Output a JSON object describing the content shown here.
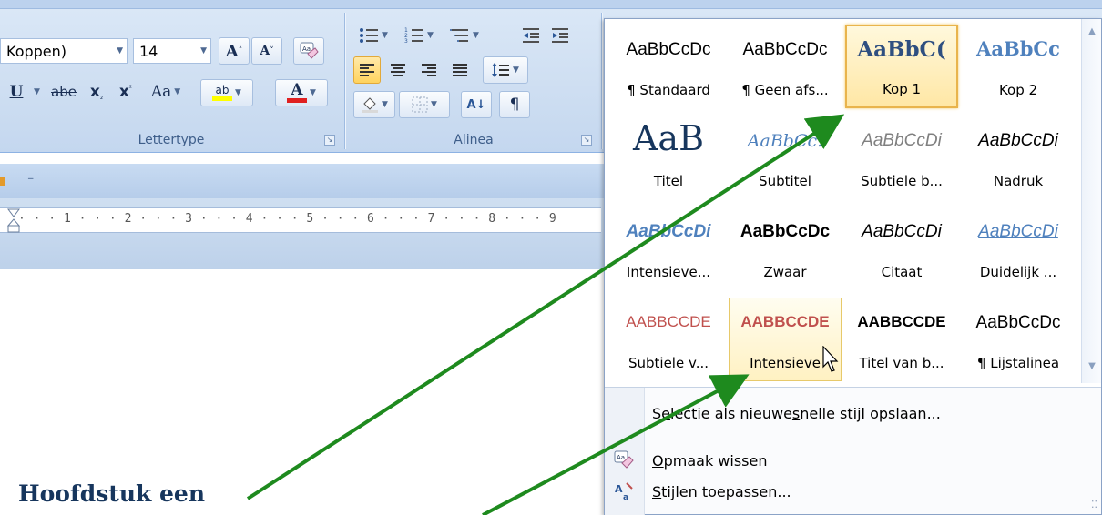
{
  "ribbon": {
    "font": {
      "name_value": "Koppen)",
      "size_value": "14",
      "group_label": "Lettertype",
      "grow_label": "A",
      "shrink_label": "A",
      "underline_label": "U",
      "strike_label": "abe",
      "subscript_label": "x",
      "superscript_label": "x",
      "case_label": "Aa",
      "highlight_label": "ab",
      "color_label": "A",
      "highlight_color": "#ffff00",
      "font_color": "#e02020"
    },
    "paragraph": {
      "group_label": "Alinea",
      "sort_label": "A↓",
      "pilcrow_label": "¶"
    }
  },
  "ruler": {
    "text": "· · · 1 · · · 2 · · · 3 · · · 4 · · · 5 · · · 6 · · · 7 · · · 8 · · · 9"
  },
  "gallery": {
    "tiles": [
      {
        "sample": "AaBbCcDc",
        "label": "¶ Standaard"
      },
      {
        "sample": "AaBbCcDc",
        "label": "¶ Geen afs..."
      },
      {
        "sample": "AaBbC(",
        "label": "Kop 1"
      },
      {
        "sample": "AaBbCc",
        "label": "Kop 2"
      },
      {
        "sample": "AaB",
        "label": "Titel"
      },
      {
        "sample": "AaBbCc.",
        "label": "Subtitel"
      },
      {
        "sample": "AaBbCcDi",
        "label": "Subtiele b..."
      },
      {
        "sample": "AaBbCcDi",
        "label": "Nadruk"
      },
      {
        "sample": "AaBbCcDi",
        "label": "Intensieve..."
      },
      {
        "sample": "AaBbCcDc",
        "label": "Zwaar"
      },
      {
        "sample": "AaBbCcDi",
        "label": "Citaat"
      },
      {
        "sample": "AaBbCcDi",
        "label": "Duidelijk ..."
      },
      {
        "sample": "AABBCCDE",
        "label": "Subtiele v..."
      },
      {
        "sample": "AABBCCDE",
        "label": "Intensieve"
      },
      {
        "sample": "AABBCCDE",
        "label": "Titel van b..."
      },
      {
        "sample": "AaBbCcDc",
        "label": "¶ Lijstalinea"
      }
    ],
    "menu": {
      "save_prefix": "S",
      "save_accel": "e",
      "save_rest": "lectie als nieuwe ",
      "save_accel2": "s",
      "save_tail": "nelle stijl opslaan...",
      "clear_accel": "O",
      "clear_rest": "pmaak wissen",
      "apply_accel": "S",
      "apply_rest": "tijlen toepassen..."
    }
  },
  "document": {
    "heading": "Hoofdstuk een"
  },
  "colors": {
    "arrow": "#1e8a1e",
    "heading": "#17365d",
    "selection_border": "#e9b44c",
    "accent": "#4f81bd"
  }
}
